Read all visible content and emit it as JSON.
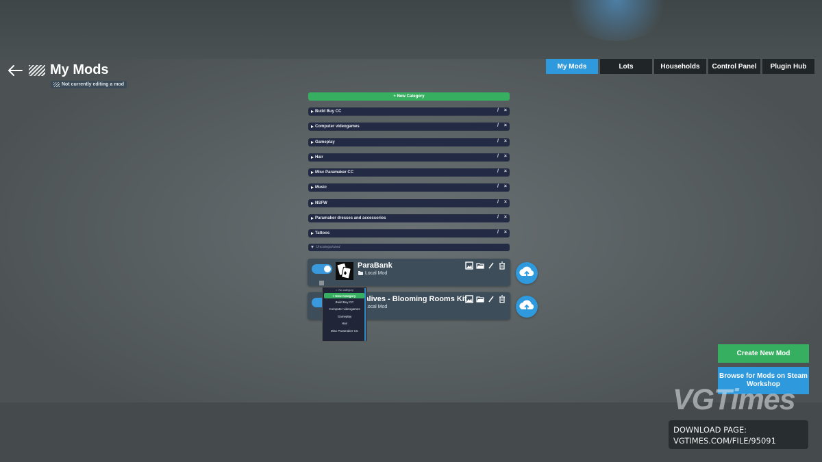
{
  "header": {
    "title": "My Mods",
    "editing_status": "Not currently editing a mod"
  },
  "tabs": [
    {
      "label": "My Mods",
      "active": true
    },
    {
      "label": "Lots",
      "active": false
    },
    {
      "label": "Households",
      "active": false
    },
    {
      "label": "Control Panel",
      "active": false
    },
    {
      "label": "Plugin Hub",
      "active": false
    }
  ],
  "categories": {
    "new_category_label": "+ New Category",
    "items": [
      {
        "label": "Build Buy CC",
        "edit": "/",
        "delete": "×"
      },
      {
        "label": "Computer videogames",
        "edit": "/",
        "delete": "×"
      },
      {
        "label": "Gameplay",
        "edit": "/",
        "delete": "×"
      },
      {
        "label": "Hair",
        "edit": "/",
        "delete": "×"
      },
      {
        "label": "Misc Paramaker CC",
        "edit": "/",
        "delete": "×"
      },
      {
        "label": "Music",
        "edit": "/",
        "delete": "×"
      },
      {
        "label": "NSFW",
        "edit": "/",
        "delete": "×"
      },
      {
        "label": "Paramaker dresses and accessories",
        "edit": "/",
        "delete": "×"
      },
      {
        "label": "Tattoos",
        "edit": "/",
        "delete": "×"
      }
    ],
    "uncategorized_label": "Uncategorized"
  },
  "mods": [
    {
      "name": "ParaBank",
      "type": "Local Mod",
      "enabled": true
    },
    {
      "name": "aralives - Blooming Rooms Kit",
      "type": "Local Mod",
      "enabled": true
    }
  ],
  "dropdown": {
    "no_category": "No category",
    "new_category": "+ New Category",
    "options": [
      "Build Buy CC",
      "Computer videogames",
      "Gameplay",
      "Hair",
      "Misc Paramaker CC"
    ]
  },
  "actions": {
    "create_new_mod": "Create New Mod",
    "browse_workshop": "Browse for Mods on Steam Workshop"
  },
  "watermark": {
    "brand": "VGTimes",
    "download_line1": "DOWNLOAD PAGE:",
    "download_line2": "VGTIMES.COM/FILE/95091"
  },
  "colors": {
    "accent_blue": "#2e99dd",
    "accent_green": "#36b060",
    "category_bar": "#232a43",
    "mod_card": "#3d4d5a"
  }
}
